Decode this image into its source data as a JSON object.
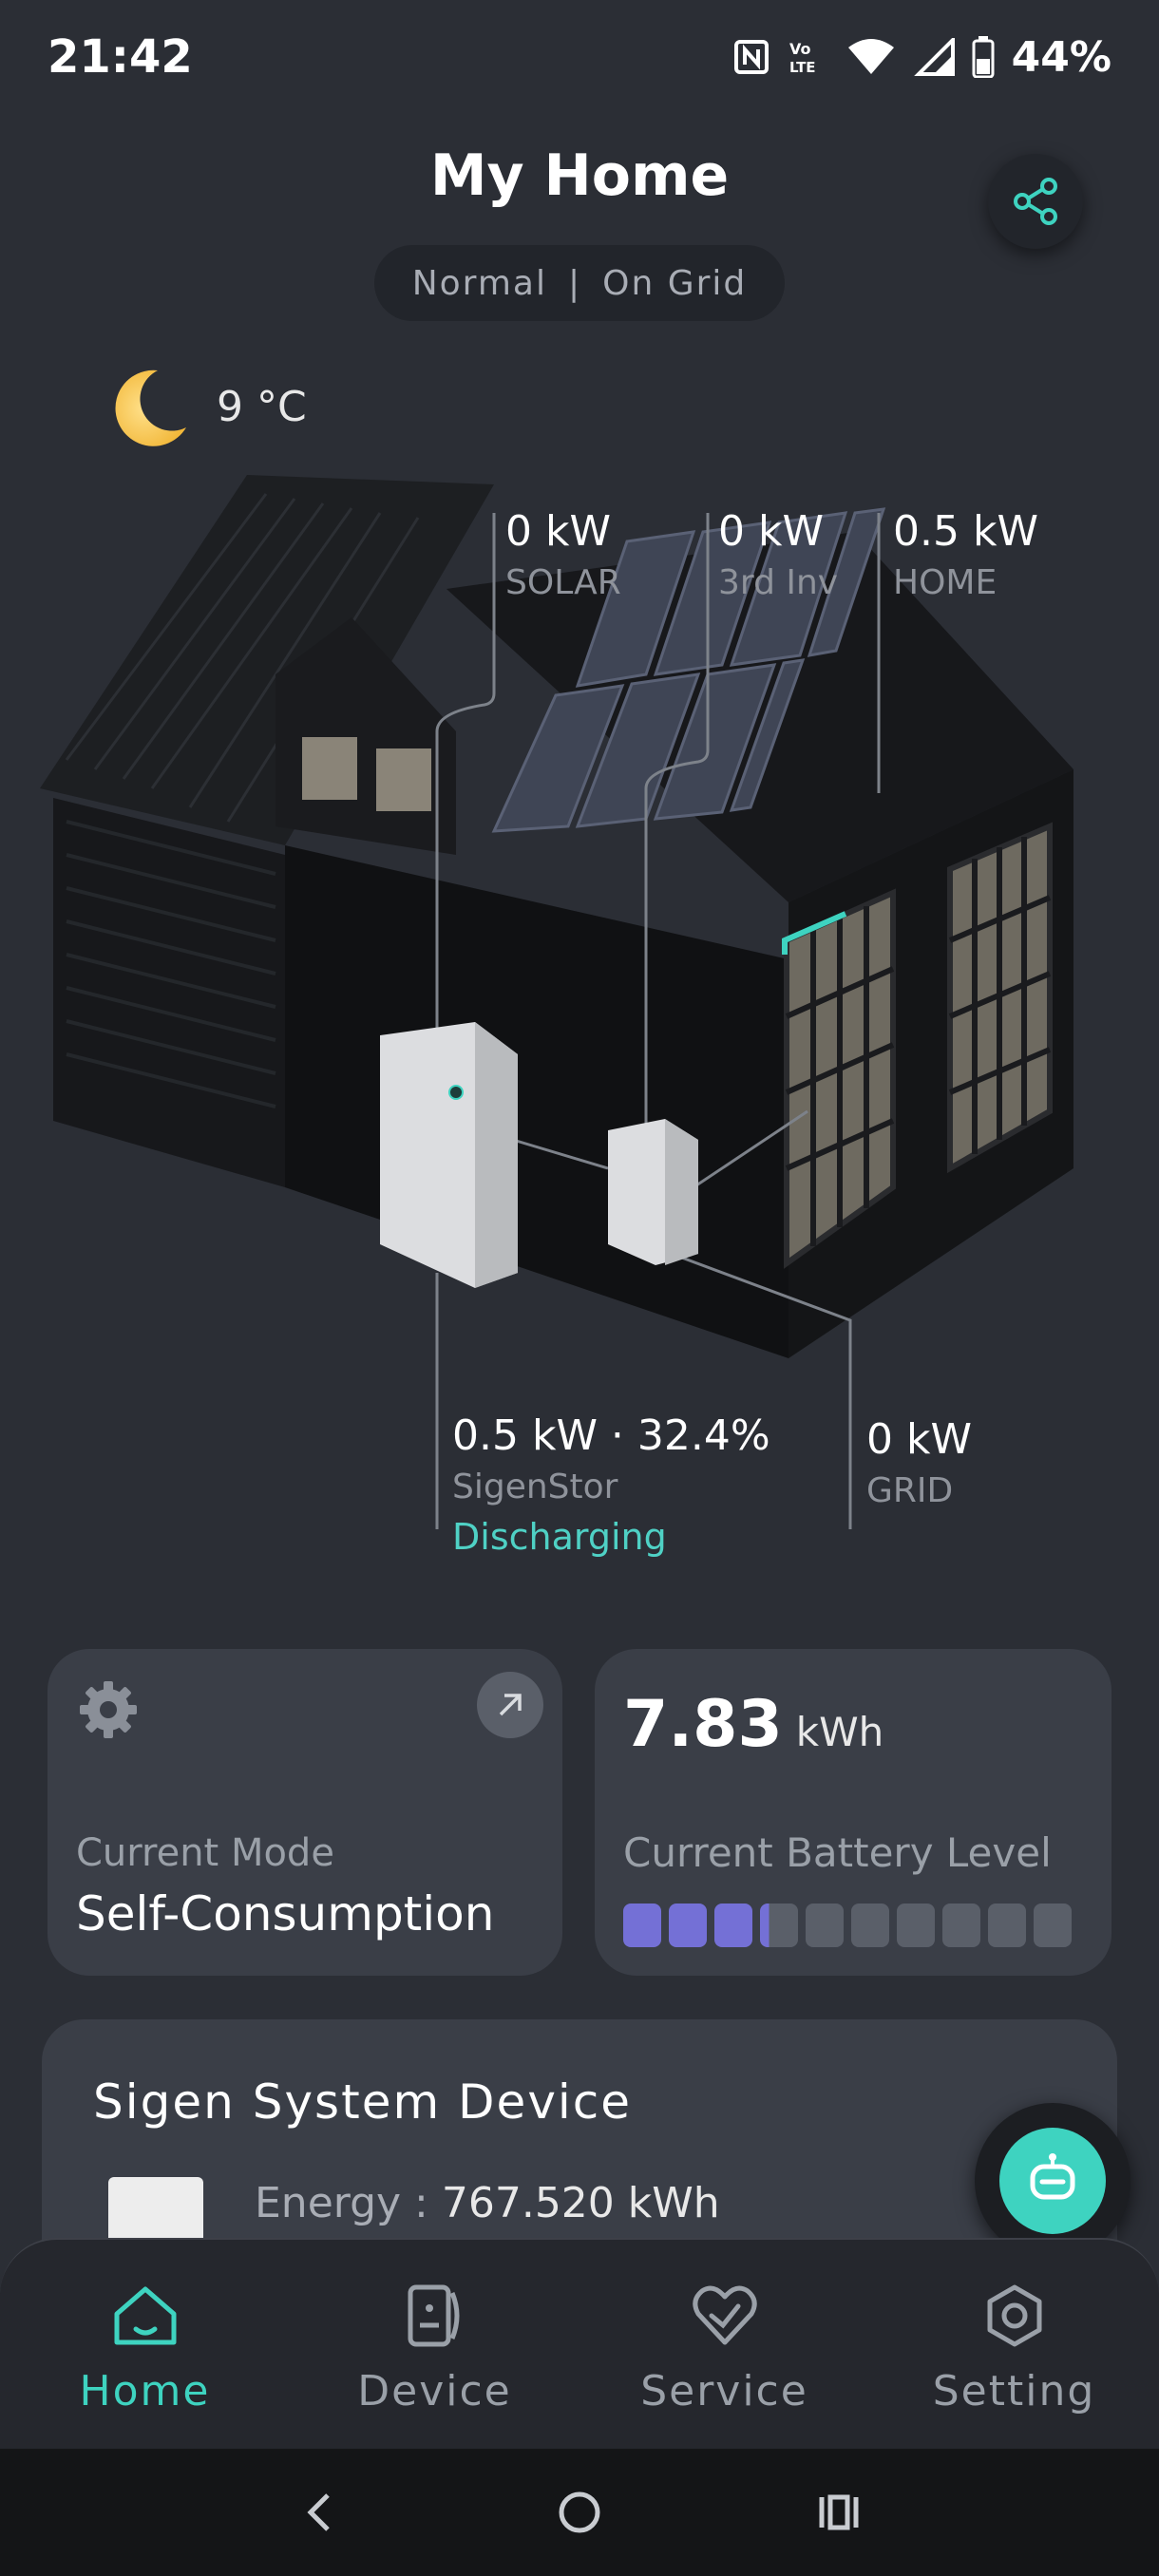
{
  "status_bar": {
    "time": "21:42",
    "battery": "44%"
  },
  "header": {
    "title": "My Home",
    "mode": "Normal",
    "separator": "|",
    "grid_status": "On Grid"
  },
  "weather": {
    "temperature": "9 °C",
    "icon": "moon-icon"
  },
  "flows": {
    "solar": {
      "value": "0 kW",
      "name": "SOLAR"
    },
    "third_inv": {
      "value": "0 kW",
      "name": "3rd Inv"
    },
    "home": {
      "value": "0.5 kW",
      "name": "HOME"
    },
    "battery": {
      "value": "0.5 kW · 32.4%",
      "name": "SigenStor",
      "status": "Discharging"
    },
    "grid": {
      "value": "0 kW",
      "name": "GRID"
    }
  },
  "mode_card": {
    "label": "Current Mode",
    "value": "Self-Consumption"
  },
  "battery_card": {
    "energy": "7.83",
    "unit": "kWh",
    "label": "Current Battery Level",
    "level_fraction": 0.324,
    "segments": 10
  },
  "device_card": {
    "title": "Sigen System Device",
    "energy_label": "Energy : ",
    "energy_value": "767.520 kWh"
  },
  "nav": {
    "items": [
      {
        "label": "Home",
        "icon": "home-icon",
        "active": true
      },
      {
        "label": "Device",
        "icon": "device-icon",
        "active": false
      },
      {
        "label": "Service",
        "icon": "service-icon",
        "active": false
      },
      {
        "label": "Setting",
        "icon": "setting-icon",
        "active": false
      }
    ]
  },
  "colors": {
    "accent": "#3ed3c0",
    "battery_fill": "#7470d6",
    "background": "#2b2e35",
    "card": "#3a3e47"
  }
}
